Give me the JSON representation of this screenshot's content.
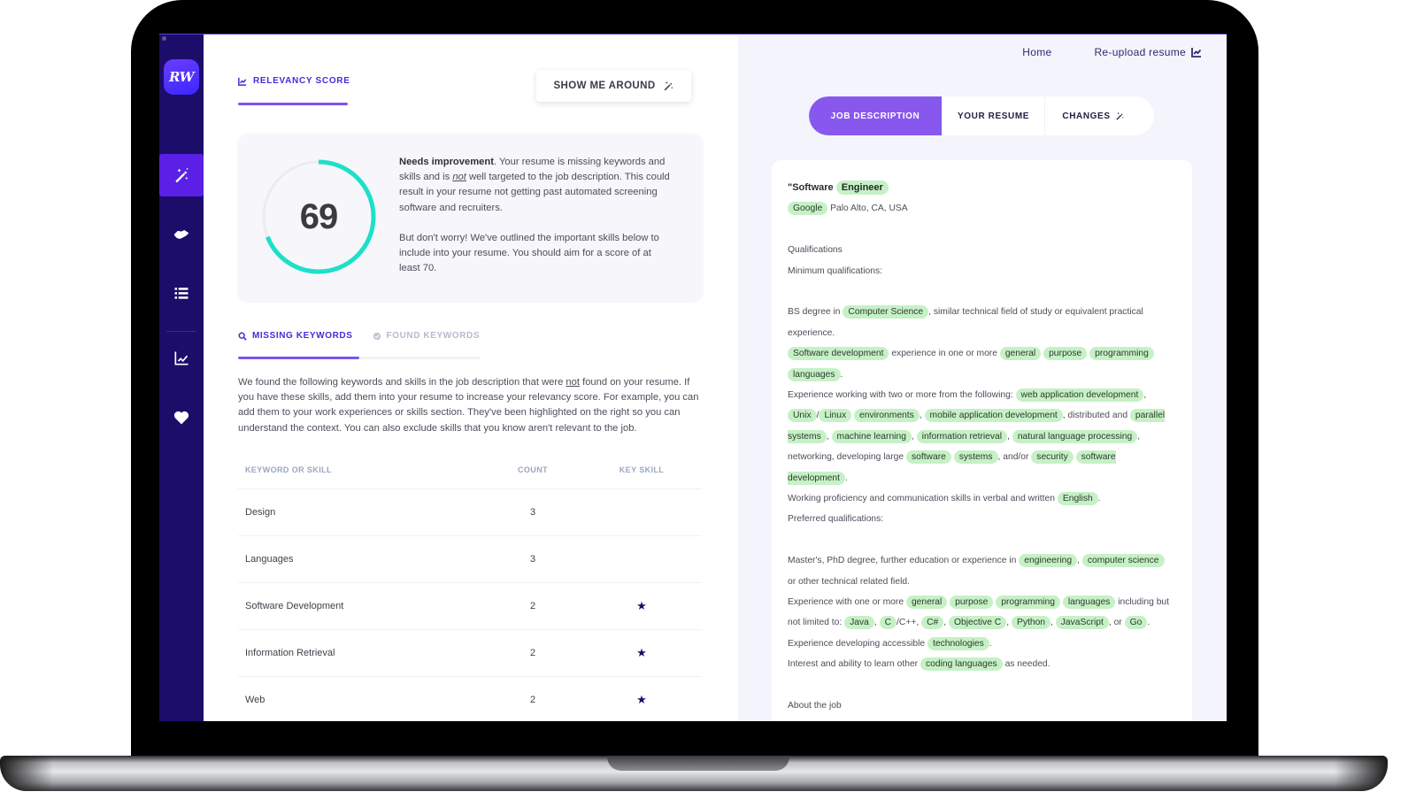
{
  "app": {
    "logo_text": "RW",
    "brand_color": "#1c0d6b",
    "accent_color": "#7b54ee",
    "highlight_color": "#c6f1c6"
  },
  "sidebar": {
    "items": [
      {
        "icon": "magic-wand-icon",
        "active": true
      },
      {
        "icon": "handshake-icon",
        "active": false
      },
      {
        "icon": "list-icon",
        "active": false
      },
      {
        "icon": "chart-line-icon",
        "active": false
      },
      {
        "icon": "heart-icon",
        "active": false
      }
    ]
  },
  "left": {
    "relevancy_tab": "RELEVANCY SCORE",
    "tour_button": "SHOW ME AROUND",
    "score": {
      "value": "69",
      "progress_percent": 69,
      "ring_color": "#1de0c8",
      "status": "Needs improvement",
      "p1_after_status": ". Your resume is missing keywords and skills and is ",
      "p1_emph": "not",
      "p1_end": " well targeted to the job description. This could result in your resume not getting past automated screening software and recruiters.",
      "p2": "But don't worry! We've outlined the important skills below to include into your resume. You should aim for a score of at least 70."
    },
    "keyword_tabs": [
      {
        "label": "MISSING KEYWORDS",
        "icon": "search-icon",
        "active": true
      },
      {
        "label": "FOUND KEYWORDS",
        "icon": "check-circle-icon",
        "active": false
      }
    ],
    "description_start": "We found the following keywords and skills in the job description that were ",
    "description_emph": "not",
    "description_end": " found on your resume. If you have these skills, add them into your resume to increase your relevancy score. For example, you can add them to your work experiences or skills section. They've been highlighted on the right so you can understand the context. You can also exclude skills that you know aren't relevant to the job.",
    "table": {
      "headers": [
        "KEYWORD OR SKILL",
        "COUNT",
        "KEY SKILL"
      ],
      "rows": [
        {
          "keyword": "Design",
          "count": "3",
          "key_skill": false
        },
        {
          "keyword": "Languages",
          "count": "3",
          "key_skill": false
        },
        {
          "keyword": "Software Development",
          "count": "2",
          "key_skill": true
        },
        {
          "keyword": "Information Retrieval",
          "count": "2",
          "key_skill": true
        },
        {
          "keyword": "Web",
          "count": "2",
          "key_skill": true
        }
      ]
    }
  },
  "right": {
    "links": {
      "home": "Home",
      "reupload": "Re-upload resume"
    },
    "segments": [
      "JOB DESCRIPTION",
      "YOUR RESUME",
      "CHANGES"
    ],
    "job": {
      "title_prefix": "\"Software",
      "title_hl": "Engineer",
      "company": "Google",
      "location": "Palo Alto, CA, USA",
      "qualifications": "Qualifications",
      "minimum": "Minimum qualifications:",
      "preferred": "Preferred qualifications:",
      "about": "About the job",
      "lines": [
        [
          [
            "t",
            "BS degree in "
          ],
          [
            "h",
            "Computer  Science"
          ],
          [
            "t",
            ", similar technical field of study or equivalent practical experience."
          ]
        ],
        [
          [
            "h",
            "Software   development"
          ],
          [
            "t",
            " experience in one or more "
          ],
          [
            "h",
            "general"
          ],
          [
            "t",
            " "
          ],
          [
            "h",
            "purpose"
          ],
          [
            "t",
            " "
          ],
          [
            "h",
            "programming"
          ],
          [
            "t",
            " "
          ],
          [
            "h",
            "languages"
          ],
          [
            "t",
            "."
          ]
        ],
        [
          [
            "t",
            "Experience working with two or more from the following: "
          ],
          [
            "h",
            "web   application   development"
          ],
          [
            "t",
            ", "
          ],
          [
            "h",
            "Unix"
          ],
          [
            "t",
            "/"
          ],
          [
            "h",
            "Linux"
          ],
          [
            "t",
            " "
          ],
          [
            "h",
            "environments"
          ],
          [
            "t",
            ", "
          ],
          [
            "h",
            "mobile   application   development"
          ],
          [
            "t",
            ", distributed and "
          ],
          [
            "h",
            "parallel  systems"
          ],
          [
            "t",
            ", "
          ],
          [
            "h",
            "machine  learning"
          ],
          [
            "t",
            ", "
          ],
          [
            "h",
            "information  retrieval"
          ],
          [
            "t",
            ", "
          ],
          [
            "h",
            "natural  language processing"
          ],
          [
            "t",
            ", networking, developing large "
          ],
          [
            "h",
            "software"
          ],
          [
            "t",
            " "
          ],
          [
            "h",
            "systems"
          ],
          [
            "t",
            ", and/or "
          ],
          [
            "h",
            "security"
          ],
          [
            "t",
            " "
          ],
          [
            "h",
            "software   development"
          ],
          [
            "t",
            "."
          ]
        ],
        [
          [
            "t",
            "Working proficiency and communication skills in verbal and written "
          ],
          [
            "h",
            "English"
          ],
          [
            "t",
            "."
          ]
        ]
      ],
      "pref_lines": [
        [
          [
            "t",
            "Master's, PhD degree, further education or experience in "
          ],
          [
            "h",
            "engineering"
          ],
          [
            "t",
            ", "
          ],
          [
            "h",
            "computer  science"
          ],
          [
            "t",
            " or other technical related field."
          ]
        ],
        [
          [
            "t",
            "Experience with one or more "
          ],
          [
            "h",
            "general"
          ],
          [
            "t",
            " "
          ],
          [
            "h",
            "purpose"
          ],
          [
            "t",
            " "
          ],
          [
            "h",
            "programming"
          ],
          [
            "t",
            " "
          ],
          [
            "h",
            "languages"
          ],
          [
            "t",
            " including but not limited to: "
          ],
          [
            "h",
            "Java"
          ],
          [
            "t",
            ", "
          ],
          [
            "h",
            "C"
          ],
          [
            "t",
            "/C++, "
          ],
          [
            "h",
            "C#"
          ],
          [
            "t",
            ", "
          ],
          [
            "h",
            "Objective  C"
          ],
          [
            "t",
            ", "
          ],
          [
            "h",
            "Python"
          ],
          [
            "t",
            ", "
          ],
          [
            "h",
            "JavaScript"
          ],
          [
            "t",
            ", or "
          ],
          [
            "h",
            "Go"
          ],
          [
            "t",
            "."
          ]
        ],
        [
          [
            "t",
            "Experience developing accessible "
          ],
          [
            "h",
            "technologies"
          ],
          [
            "t",
            "."
          ]
        ],
        [
          [
            "t",
            "Interest and ability to learn other "
          ],
          [
            "h",
            "coding   languages"
          ],
          [
            "t",
            " as needed."
          ]
        ]
      ]
    }
  }
}
